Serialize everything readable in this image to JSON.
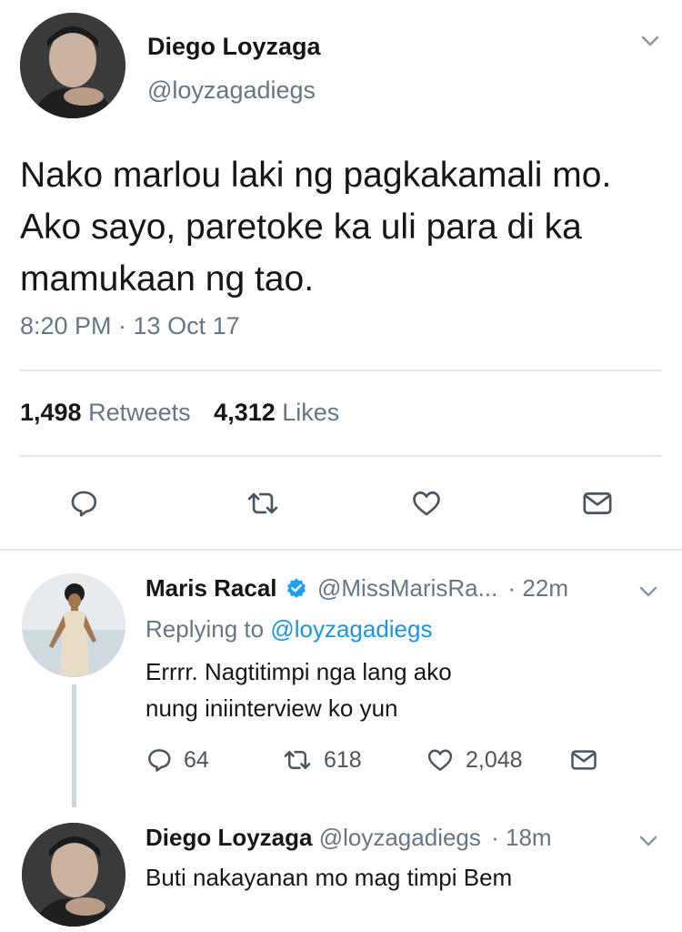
{
  "main_tweet": {
    "name": "Diego Loyzaga",
    "handle": "@loyzagadiegs",
    "text": "Nako marlou laki ng pagkakamali mo. Ako sayo, paretoke ka uli para di ka mamukaan ng tao.",
    "timestamp": "8:20 PM · 13 Oct 17",
    "retweets_count": "1,498",
    "retweets_label": "Retweets",
    "likes_count": "4,312",
    "likes_label": "Likes"
  },
  "reply_1": {
    "name": "Maris Racal",
    "handle": "@MissMarisRa...",
    "time": "· 22m",
    "replying_prefix": "Replying to",
    "replying_handle": "@loyzagadiegs",
    "text": "Errrr. Nagtitimpi nga lang ako nung iniinterview ko yun",
    "reply_count": "64",
    "retweet_count": "618",
    "like_count": "2,048"
  },
  "reply_2": {
    "name": "Diego Loyzaga",
    "handle": "@loyzagadiegs",
    "time": "· 18m",
    "text": "Buti nakayanan mo mag timpi Bem"
  },
  "colors": {
    "text": "#14171a",
    "muted": "#657786",
    "link": "#1b95e0",
    "divider": "#e1e8ed",
    "verified": "#1da1f2"
  },
  "icons": [
    "chevron-down-icon",
    "reply-icon",
    "retweet-icon",
    "like-icon",
    "dm-icon",
    "verified-badge-icon"
  ]
}
